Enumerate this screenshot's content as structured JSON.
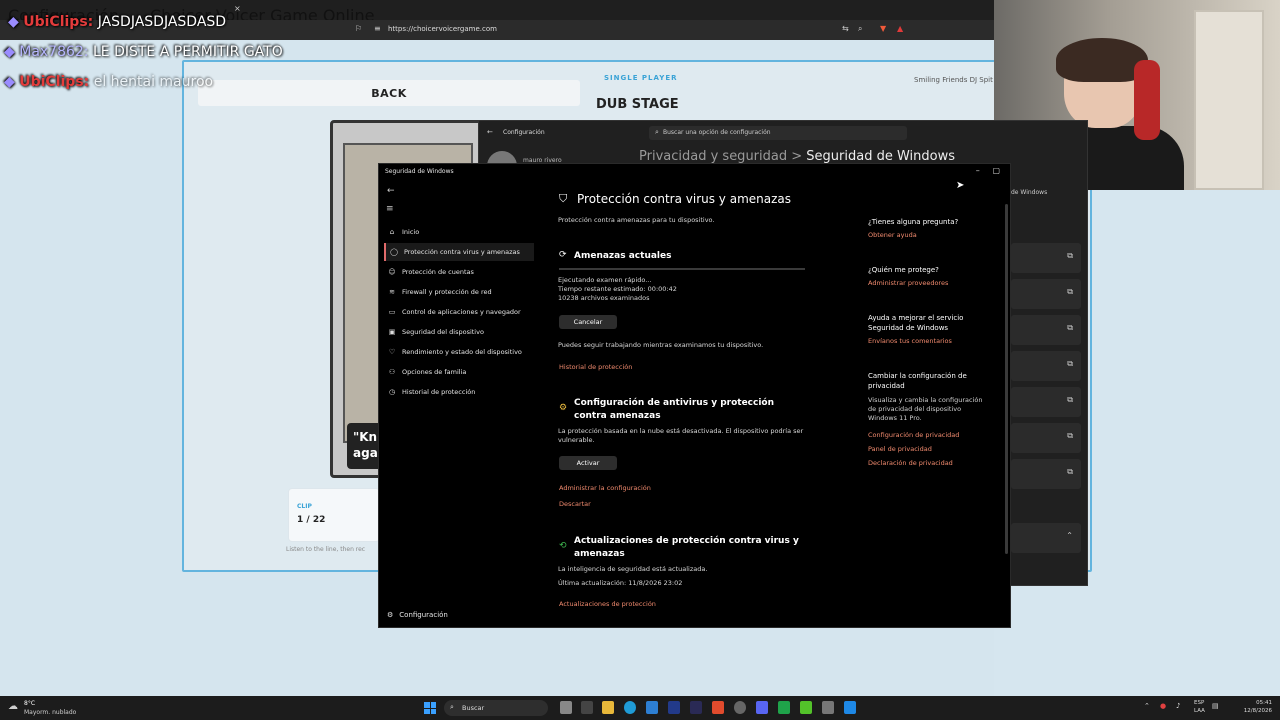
{
  "browser": {
    "tabs": [
      "Configuración",
      "Choicer Voicer Game Online"
    ],
    "url": "https://choicervoicergame.com"
  },
  "game": {
    "back_label": "BACK",
    "mode": "SINGLE PLAYER",
    "stage": "DUB STAGE",
    "show": "Smiling Friends DJ Spit",
    "subtitle": "\"Kn\nagai",
    "clip_label": "CLIP",
    "clip_counter": "1 / 22",
    "hint": "Listen to the line, then rec"
  },
  "chat": [
    {
      "user": "UbiClips:",
      "message": "JASDJASDJASDASD"
    },
    {
      "user": "Max7862:",
      "message": "LE DISTE A PERMITIR GATO"
    },
    {
      "user": "UbiClips:",
      "message": "el hentai mauroo"
    }
  ],
  "settings": {
    "title": "Configuración",
    "search_placeholder": "Buscar una opción de configuración",
    "user": "mauro rivero",
    "breadcrumb_parent": "Privacidad y seguridad",
    "breadcrumb_sep": ">",
    "breadcrumb_current": "Seguridad de Windows",
    "right_label": "de Windows"
  },
  "security": {
    "window_title": "Seguridad de Windows",
    "nav": [
      {
        "icon": "home-icon",
        "glyph": "⌂",
        "label": "Inicio"
      },
      {
        "icon": "shield-icon",
        "glyph": "◯",
        "label": "Protección contra virus y amenazas"
      },
      {
        "icon": "person-icon",
        "glyph": "☺",
        "label": "Protección de cuentas"
      },
      {
        "icon": "wifi-icon",
        "glyph": "≋",
        "label": "Firewall y protección de red"
      },
      {
        "icon": "app-icon",
        "glyph": "▭",
        "label": "Control de aplicaciones y navegador"
      },
      {
        "icon": "device-icon",
        "glyph": "▣",
        "label": "Seguridad del dispositivo"
      },
      {
        "icon": "heart-icon",
        "glyph": "♡",
        "label": "Rendimiento y estado del dispositivo"
      },
      {
        "icon": "family-icon",
        "glyph": "⚇",
        "label": "Opciones de familia"
      },
      {
        "icon": "history-icon",
        "glyph": "◷",
        "label": "Historial de protección"
      }
    ],
    "config_label": "Configuración",
    "page_title": "Protección contra virus y amenazas",
    "page_subtitle": "Protección contra amenazas para tu dispositivo.",
    "threats_title": "Amenazas actuales",
    "scan_progress": 0.0,
    "scan_status": "Ejecutando examen rápido...",
    "scan_time": "Tiempo restante estimado: 00:00:42",
    "scan_files": "10238 archivos examinados",
    "cancel_label": "Cancelar",
    "keep_working": "Puedes seguir trabajando mientras examinamos tu dispositivo.",
    "history_link": "Historial de protección",
    "av_title": "Configuración de antivirus y protección contra amenazas",
    "av_desc": "La protección basada en la nube está desactivada. El dispositivo podría ser vulnerable.",
    "activate_label": "Activar",
    "manage_link": "Administrar la configuración",
    "dismiss_link": "Descartar",
    "updates_title": "Actualizaciones de protección contra virus y amenazas",
    "updates_status": "La inteligencia de seguridad está actualizada.",
    "updates_last": "Última actualización: 11/8/2026 23:02",
    "updates_link": "Actualizaciones de protección",
    "side": {
      "q1": "¿Tienes alguna pregunta?",
      "q1_link": "Obtener ayuda",
      "q2": "¿Quién me protege?",
      "q2_link": "Administrar proveedores",
      "q3": "Ayuda a mejorar el servicio Seguridad de Windows",
      "q3_link": "Envíanos tus comentarios",
      "q4": "Cambiar la configuración de privacidad",
      "q4_text": "Visualiza y cambia la configuración de privacidad del dispositivo Windows 11 Pro.",
      "q4_link1": "Configuración de privacidad",
      "q4_link2": "Panel de privacidad",
      "q4_link3": "Declaración de privacidad"
    }
  },
  "taskbar": {
    "weather_temp": "8°C",
    "weather_desc": "Mayorm. nublado",
    "search_label": "Buscar",
    "lang1": "ESP",
    "lang2": "LAA",
    "time": "05:41",
    "date": "12/8/2026"
  }
}
